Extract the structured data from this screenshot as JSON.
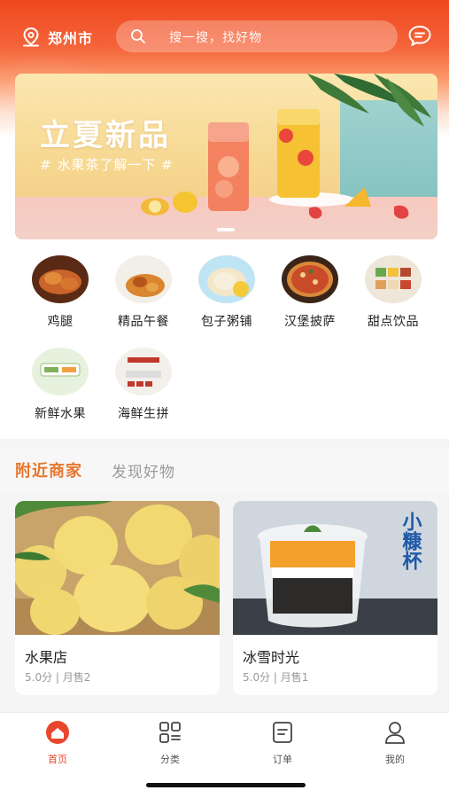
{
  "header": {
    "city": "郑州市",
    "search_placeholder": "搜一搜，找好物"
  },
  "banner": {
    "title": "立夏新品",
    "subtitle": "# 水果茶了解一下 #"
  },
  "categories": [
    {
      "label": "鸡腿"
    },
    {
      "label": "精品午餐"
    },
    {
      "label": "包子粥铺"
    },
    {
      "label": "汉堡披萨"
    },
    {
      "label": "甜点饮品"
    },
    {
      "label": "新鲜水果"
    },
    {
      "label": "海鲜生拼"
    }
  ],
  "tabs": {
    "active": "附近商家",
    "other": "发现好物"
  },
  "shops": [
    {
      "name": "水果店",
      "meta": "5.0分 | 月售2"
    },
    {
      "name": "冰雪时光",
      "meta": "5.0分 | 月售1",
      "image_text": "小糠杯"
    }
  ],
  "bottom_nav": [
    {
      "label": "首页",
      "active": true
    },
    {
      "label": "分类"
    },
    {
      "label": "订单"
    },
    {
      "label": "我的"
    }
  ],
  "colors": {
    "brand": "#f0471e",
    "active_tab": "#e8772e"
  }
}
